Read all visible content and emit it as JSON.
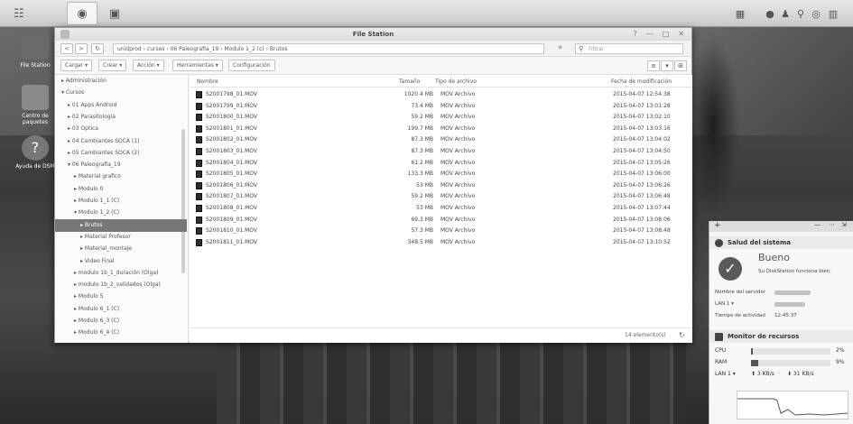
{
  "window": {
    "title": "File Station",
    "controls": {
      "help": "?",
      "minimize": "—",
      "maximize": "□",
      "close": "✕"
    }
  },
  "nav": {
    "back": "<",
    "forward": ">",
    "refresh": "↻",
    "path": "unidprod  ›  cursos  ›  06 Paleografia_19  ›  Modulo 1_2 (c)  ›  Brutos",
    "star": "★",
    "filter_placeholder": "Filtrar"
  },
  "toolbar": {
    "upload": "Cargar ▾",
    "create": "Crear ▾",
    "action": "Acción ▾",
    "tools": "Herramientas ▾",
    "settings": "Configuración",
    "view_list": "≡",
    "view_dropdown": "▾",
    "view_grid": "⊞"
  },
  "tree": [
    {
      "label": "▸ Administración",
      "indent": 1
    },
    {
      "label": "▾ Cursos",
      "indent": 1
    },
    {
      "label": "▸ 01 Apps Android",
      "indent": 2
    },
    {
      "label": "▸ 02 Parasitología",
      "indent": 2
    },
    {
      "label": "▸ 03 Optica",
      "indent": 2
    },
    {
      "label": "▸ 04 Cambiantes SOCA (1)",
      "indent": 2
    },
    {
      "label": "▸ 05 Cambiantes SOCA (2)",
      "indent": 2
    },
    {
      "label": "▾ 06 Paleografia_19",
      "indent": 2
    },
    {
      "label": "▸ Material grafico",
      "indent": 3
    },
    {
      "label": "▸ Modulo 0",
      "indent": 3
    },
    {
      "label": "▸ Modulo 1_1 (C)",
      "indent": 3
    },
    {
      "label": "▾ Modulo 1_2 (C)",
      "indent": 3
    },
    {
      "label": "▸ Brutos",
      "indent": 4,
      "selected": true
    },
    {
      "label": "▸ Material Profesor",
      "indent": 4
    },
    {
      "label": "▸ Material_montaje",
      "indent": 4
    },
    {
      "label": "▸ Video Final",
      "indent": 4
    },
    {
      "label": "▸ modulo 1b_1_duración (Olga)",
      "indent": 3
    },
    {
      "label": "▸ modulo 1b_2_validados (Olga)",
      "indent": 3
    },
    {
      "label": "▸ Modulo 5",
      "indent": 3
    },
    {
      "label": "▸ Modulo 6_1 (C)",
      "indent": 3
    },
    {
      "label": "▸ Modulo 6_3 (C)",
      "indent": 3
    },
    {
      "label": "▸ Modulo 6_4 (C)",
      "indent": 3
    }
  ],
  "columns": {
    "name": "Nombre",
    "size": "Tamaño",
    "type": "Tipo de archivo",
    "modified": "Fecha de modificación"
  },
  "files": [
    {
      "name": "S2001798_01.MOV",
      "size": "1020.4 MB",
      "type": "MOV Archivo",
      "modified": "2015-04-07 12:54:38"
    },
    {
      "name": "S2001799_01.MOV",
      "size": "73.4 MB",
      "type": "MOV Archivo",
      "modified": "2015-04-07 13:01:28"
    },
    {
      "name": "S2001800_01.MOV",
      "size": "59.2 MB",
      "type": "MOV Archivo",
      "modified": "2015-04-07 13:02:10"
    },
    {
      "name": "S2001801_01.MOV",
      "size": "199.7 MB",
      "type": "MOV Archivo",
      "modified": "2015-04-07 13:03:16"
    },
    {
      "name": "S2001802_01.MOV",
      "size": "87.3 MB",
      "type": "MOV Archivo",
      "modified": "2015-04-07 13:04:02"
    },
    {
      "name": "S2001803_01.MOV",
      "size": "87.3 MB",
      "type": "MOV Archivo",
      "modified": "2015-04-07 13:04:50"
    },
    {
      "name": "S2001804_01.MOV",
      "size": "61.2 MB",
      "type": "MOV Archivo",
      "modified": "2015-04-07 13:05:26"
    },
    {
      "name": "S2001805_01.MOV",
      "size": "133.3 MB",
      "type": "MOV Archivo",
      "modified": "2015-04-07 13:06:00"
    },
    {
      "name": "S2001806_01.MOV",
      "size": "53 MB",
      "type": "MOV Archivo",
      "modified": "2015-04-07 13:06:26"
    },
    {
      "name": "S2001807_01.MOV",
      "size": "59.2 MB",
      "type": "MOV Archivo",
      "modified": "2015-04-07 13:06:48"
    },
    {
      "name": "S2001808_01.MOV",
      "size": "53 MB",
      "type": "MOV Archivo",
      "modified": "2015-04-07 13:07:44"
    },
    {
      "name": "S2001809_01.MOV",
      "size": "69.3 MB",
      "type": "MOV Archivo",
      "modified": "2015-04-07 13:08:06"
    },
    {
      "name": "S2001810_01.MOV",
      "size": "57.3 MB",
      "type": "MOV Archivo",
      "modified": "2015-04-07 13:08:48"
    },
    {
      "name": "S2001811_01.MOV",
      "size": "348.5 MB",
      "type": "MOV Archivo",
      "modified": "2015-04-07 13:10:52"
    }
  ],
  "status": {
    "count": "14 elemento(s)",
    "refresh": "↻"
  },
  "desktop": [
    {
      "label": "File Station"
    },
    {
      "label": "Centro de paquetes"
    },
    {
      "label": "Ayuda de DSM"
    }
  ],
  "widget": {
    "top_controls": {
      "add": "+",
      "minimize": "—",
      "settings": "⋯",
      "pin": "⇲"
    },
    "health_title": "Salud del sistema",
    "health_status": "Bueno",
    "health_message": "Su DiskStation funciona bien.",
    "check": "✓",
    "server_name_label": "Nombre del servidor",
    "lan_label": "LAN 1 ▾",
    "uptime_label": "Tiempo de actividad",
    "uptime_value": "12:45:37",
    "monitor_title": "Monitor de recursos",
    "cpu_label": "CPU",
    "cpu_value": "2%",
    "cpu_fraction": 0.02,
    "ram_label": "RAM",
    "ram_value": "9%",
    "ram_fraction": 0.09,
    "net_label": "LAN 1 ▾",
    "net_up": "⬆ 3 KB/s",
    "net_down": "⬇ 31 KB/s"
  }
}
